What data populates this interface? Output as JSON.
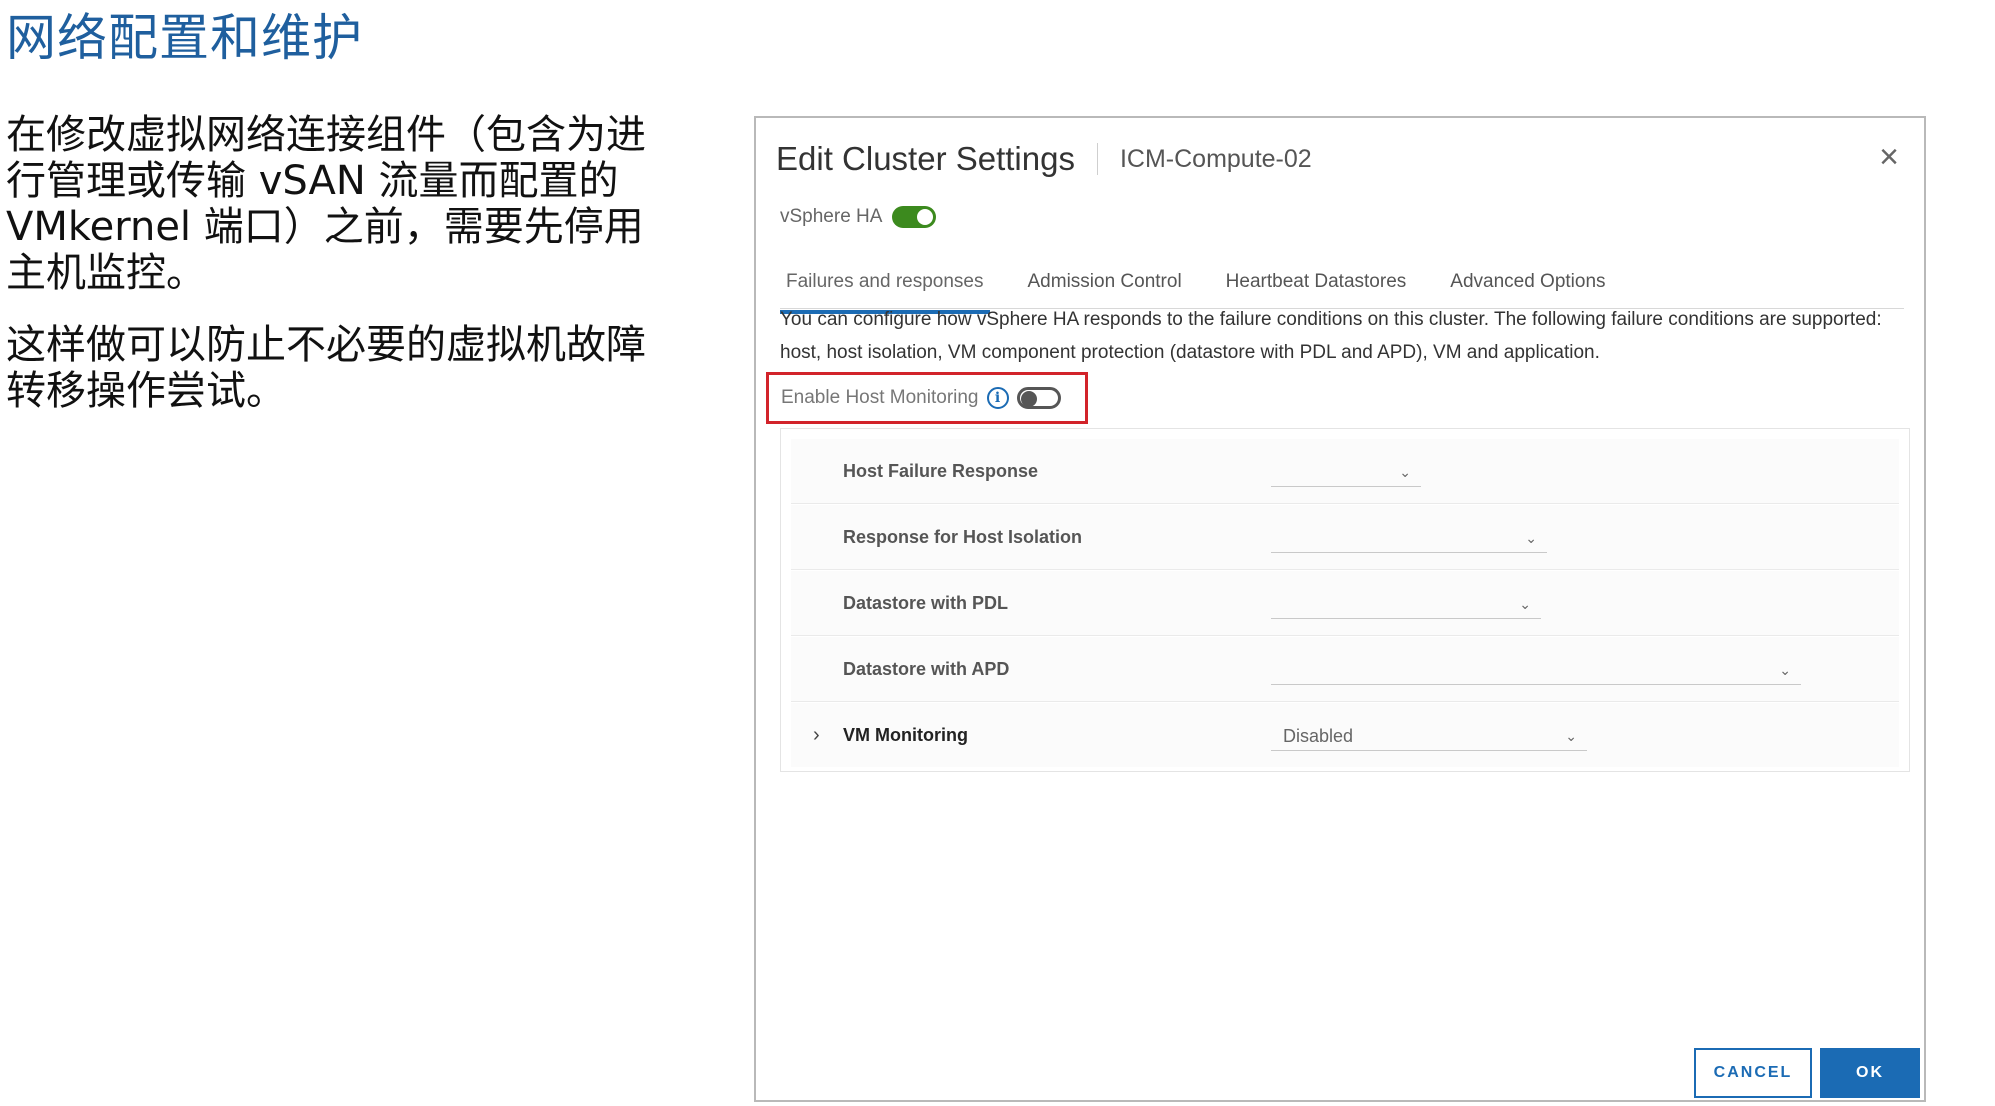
{
  "slide": {
    "title": "网络配置和维护",
    "paragraph1": "在修改虚拟网络连接组件（包含为进行管理或传输 vSAN 流量而配置的 VMkernel 端口）之前，需要先停用主机监控。",
    "paragraph2": "这样做可以防止不必要的虚拟机故障转移操作尝试。"
  },
  "dialog": {
    "title": "Edit Cluster Settings",
    "subtitle": "ICM-Compute-02",
    "close_icon": "close-icon",
    "vsphere_ha": {
      "label": "vSphere HA",
      "enabled": true
    },
    "tabs": [
      {
        "label": "Failures and responses",
        "active": true
      },
      {
        "label": "Admission Control",
        "active": false
      },
      {
        "label": "Heartbeat Datastores",
        "active": false
      },
      {
        "label": "Advanced Options",
        "active": false
      }
    ],
    "description": "You can configure how vSphere HA responds to the failure conditions on this cluster. The following failure conditions are supported: host, host isolation, VM component protection (datastore with PDL and APD), VM and application.",
    "host_monitoring": {
      "label": "Enable Host Monitoring",
      "enabled": false,
      "info_icon": "info-icon"
    },
    "settings": [
      {
        "label": "Host Failure Response",
        "value": ""
      },
      {
        "label": "Response for Host Isolation",
        "value": ""
      },
      {
        "label": "Datastore with PDL",
        "value": ""
      },
      {
        "label": "Datastore with APD",
        "value": ""
      },
      {
        "label": "VM Monitoring",
        "value": "Disabled"
      }
    ],
    "buttons": {
      "cancel": "CANCEL",
      "ok": "OK"
    },
    "colors": {
      "accent": "#1b6bb4",
      "toggle_on": "#3c8a1e",
      "highlight": "#d2232a"
    }
  }
}
